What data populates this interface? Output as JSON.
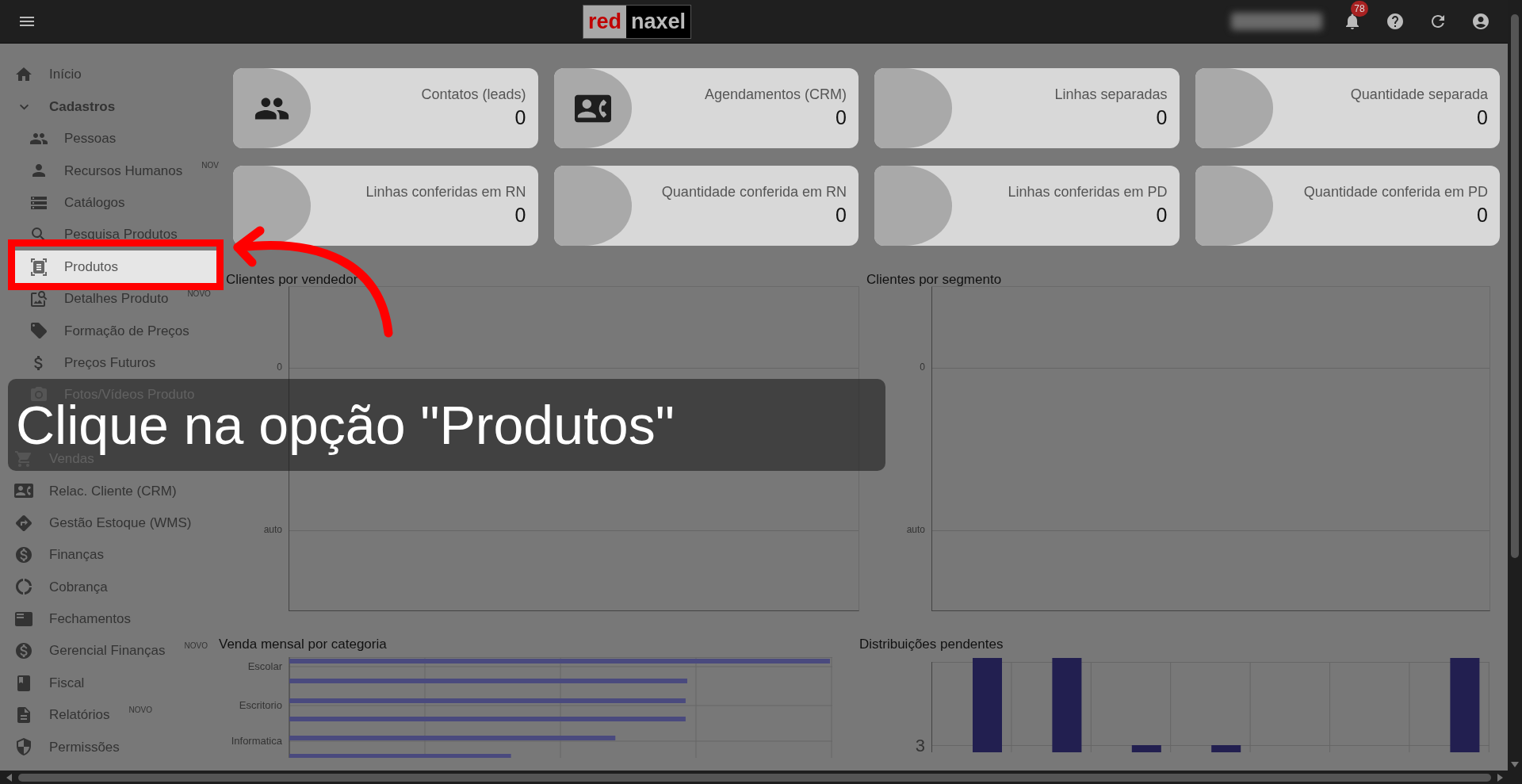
{
  "top_bar": {
    "logo": {
      "part_1": "red",
      "part_2": "naxel"
    },
    "notifications": {
      "count": "78"
    }
  },
  "sidebar": {
    "items": [
      {
        "label": "Início",
        "kind": "link",
        "selected": false
      },
      {
        "label": "Cadastros",
        "kind": "group",
        "expanded": true,
        "selected": false,
        "children": [
          {
            "label": "Pessoas",
            "selected": false
          },
          {
            "label": "Recursos Humanos",
            "badge": "NOV",
            "selected": false
          },
          {
            "label": "Catálogos",
            "selected": false
          },
          {
            "label": "Pesquisa Produtos",
            "selected": false
          },
          {
            "label": "Produtos",
            "selected": true
          },
          {
            "label": "Detalhes Produto",
            "badge": "NOVO",
            "selected": false
          },
          {
            "label": "Formação de Preços",
            "selected": false
          },
          {
            "label": "Preços Futuros",
            "selected": false
          },
          {
            "label": "Fotos/Vídeos Produto",
            "selected": false
          }
        ]
      },
      {
        "label": "Vendas",
        "kind": "link",
        "selected": false
      },
      {
        "label": "Relac. Cliente (CRM)",
        "kind": "link",
        "selected": false
      },
      {
        "label": "Gestão Estoque (WMS)",
        "kind": "link",
        "selected": false
      },
      {
        "label": "Finanças",
        "kind": "link",
        "selected": false
      },
      {
        "label": "Cobrança",
        "kind": "link",
        "selected": false
      },
      {
        "label": "Fechamentos",
        "kind": "link",
        "selected": false
      },
      {
        "label": "Gerencial Finanças",
        "badge": "NOVO",
        "kind": "link",
        "selected": false
      },
      {
        "label": "Fiscal",
        "kind": "link",
        "selected": false
      },
      {
        "label": "Relatórios",
        "badge": "NOVO",
        "kind": "link",
        "selected": false
      },
      {
        "label": "Permissões",
        "kind": "link",
        "selected": false
      }
    ]
  },
  "stat_cards": [
    {
      "label": "Contatos (leads)",
      "value": "0"
    },
    {
      "label": "Agendamentos (CRM)",
      "value": "0"
    },
    {
      "label": "Linhas separadas",
      "value": "0"
    },
    {
      "label": "Quantidade separada",
      "value": "0"
    },
    {
      "label": "Linhas conferidas em RN",
      "value": "0"
    },
    {
      "label": "Quantidade conferida em RN",
      "value": "0"
    },
    {
      "label": "Linhas conferidas em PD",
      "value": "0"
    },
    {
      "label": "Quantidade conferida em PD",
      "value": "0"
    }
  ],
  "charts": [
    {
      "title": "Clientes por vendedor",
      "axis_labels": [
        "0",
        "auto"
      ]
    },
    {
      "title": "Clientes por segmento",
      "axis_labels": [
        "0",
        "auto"
      ]
    },
    {
      "title": "Venda mensal por categoria",
      "categories": [
        "Escolar",
        "Escritorio",
        "Informatica"
      ]
    },
    {
      "title": "Distribuições pendentes",
      "axis_labels": [
        "3"
      ]
    }
  ],
  "tutorial": {
    "caption": "Clique na opção \"Produtos\""
  }
}
